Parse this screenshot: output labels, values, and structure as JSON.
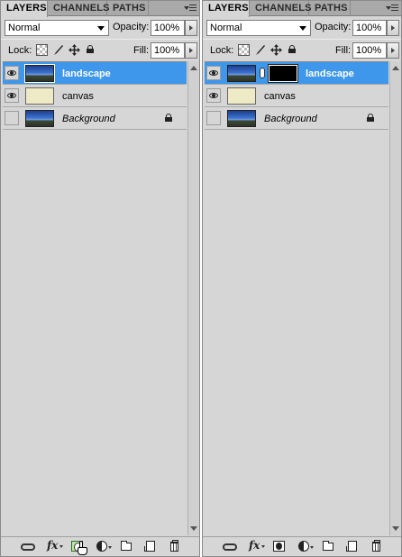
{
  "panels": [
    {
      "tabs": [
        "LAYERS",
        "CHANNELS",
        "PATHS"
      ],
      "blend_mode": "Normal",
      "opacity_label": "Opacity:",
      "opacity_value": "100%",
      "lock_label": "Lock:",
      "fill_label": "Fill:",
      "fill_value": "100%",
      "layers": [
        {
          "name": "landscape",
          "visible": true,
          "selected": true,
          "has_mask": false,
          "locked": false
        },
        {
          "name": "canvas",
          "visible": true,
          "selected": false,
          "has_mask": false,
          "locked": false
        },
        {
          "name": "Background",
          "visible": false,
          "selected": false,
          "has_mask": false,
          "locked": true
        }
      ],
      "toolbar": [
        "link-layers-icon",
        "fx-icon",
        "add-layer-mask-icon",
        "adjustment-layer-icon",
        "new-group-icon",
        "new-layer-icon",
        "trash-icon"
      ],
      "add_mask_hovered": true
    },
    {
      "tabs": [
        "LAYERS",
        "CHANNELS",
        "PATHS"
      ],
      "blend_mode": "Normal",
      "opacity_label": "Opacity:",
      "opacity_value": "100%",
      "lock_label": "Lock:",
      "fill_label": "Fill:",
      "fill_value": "100%",
      "layers": [
        {
          "name": "landscape",
          "visible": true,
          "selected": true,
          "has_mask": true,
          "locked": false
        },
        {
          "name": "canvas",
          "visible": true,
          "selected": false,
          "has_mask": false,
          "locked": false
        },
        {
          "name": "Background",
          "visible": false,
          "selected": false,
          "has_mask": false,
          "locked": true
        }
      ],
      "toolbar": [
        "link-layers-icon",
        "fx-icon",
        "add-layer-mask-icon",
        "adjustment-layer-icon",
        "new-group-icon",
        "new-layer-icon",
        "trash-icon"
      ],
      "add_mask_hovered": false
    }
  ],
  "colors": {
    "selection": "#3e97ea",
    "panel_bg": "#d6d6d6"
  }
}
